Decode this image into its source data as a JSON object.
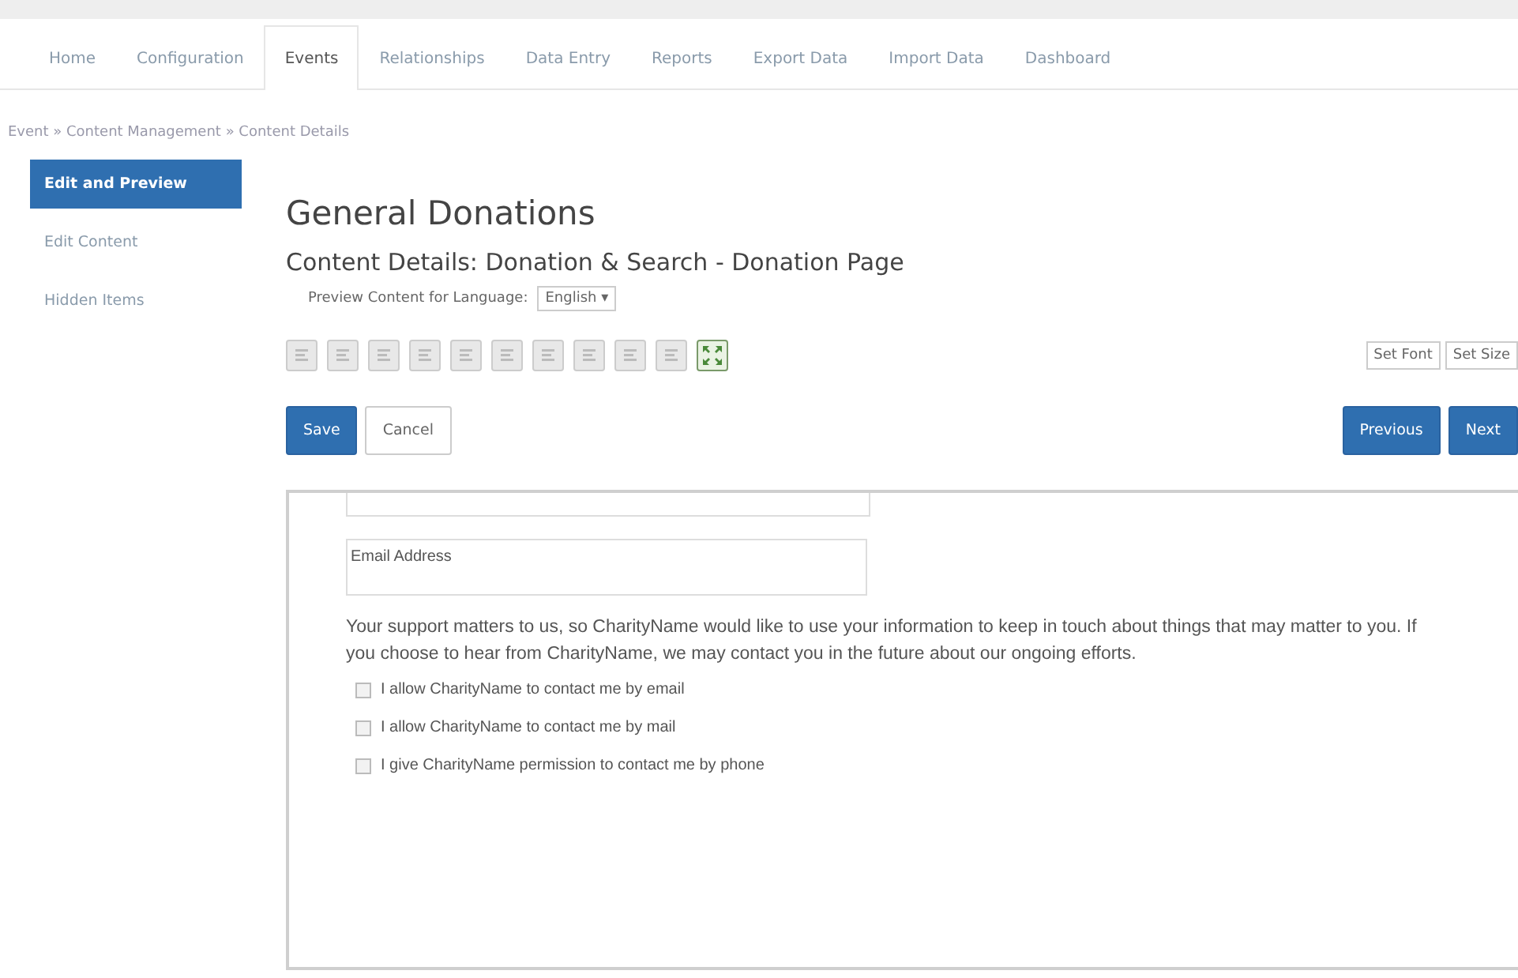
{
  "tabs": [
    {
      "label": "Home",
      "selected": false
    },
    {
      "label": "Configuration",
      "selected": false
    },
    {
      "label": "Events",
      "selected": true
    },
    {
      "label": "Relationships",
      "selected": false
    },
    {
      "label": "Data Entry",
      "selected": false
    },
    {
      "label": "Reports",
      "selected": false
    },
    {
      "label": "Export Data",
      "selected": false
    },
    {
      "label": "Import Data",
      "selected": false
    },
    {
      "label": "Dashboard",
      "selected": false
    }
  ],
  "breadcrumb": "Event » Content Management » Content Details",
  "sidebar": {
    "items": [
      {
        "label": "Edit and Preview",
        "selected": true
      },
      {
        "label": "Edit Content",
        "selected": false
      },
      {
        "label": "Hidden Items",
        "selected": false
      }
    ]
  },
  "title": "General Donations",
  "subtitle": "Content Details: Donation & Search - Donation Page",
  "language": {
    "label": "Preview Content for Language:",
    "value": "English ▾"
  },
  "toolbar": [
    {
      "kind": "format",
      "disabled": true
    },
    {
      "kind": "format",
      "disabled": true
    },
    {
      "kind": "format",
      "disabled": true
    },
    {
      "kind": "format",
      "disabled": true
    },
    {
      "kind": "format",
      "disabled": true
    },
    {
      "kind": "format",
      "disabled": true
    },
    {
      "kind": "format",
      "disabled": true
    },
    {
      "kind": "format",
      "disabled": true
    },
    {
      "kind": "format",
      "disabled": true
    },
    {
      "kind": "format",
      "disabled": true
    },
    {
      "kind": "fullscreen",
      "disabled": false
    }
  ],
  "font_select": {
    "value": "Set Font"
  },
  "size_select": {
    "value": "Set Size"
  },
  "actions": {
    "left": [
      {
        "label": "Save",
        "kind": "primary"
      },
      {
        "label": "Cancel",
        "kind": "default"
      }
    ],
    "right": [
      {
        "label": "Previous",
        "kind": "primary"
      },
      {
        "label": "Next",
        "kind": "primary"
      }
    ]
  },
  "preview": {
    "fields": [
      {
        "placeholder": "Email Address"
      }
    ],
    "paragraph": "Your support matters to us, so CharityName would like to use your information to keep in touch about things that may matter to you. If you choose to hear from CharityName, we may contact you in the future about our ongoing efforts.",
    "checkboxes": [
      {
        "label": "I allow CharityName to contact me by email",
        "checked": false
      },
      {
        "label": "I allow CharityName to contact me by mail",
        "checked": false
      },
      {
        "label": "I give CharityName permission to contact me by phone",
        "checked": false
      }
    ]
  }
}
